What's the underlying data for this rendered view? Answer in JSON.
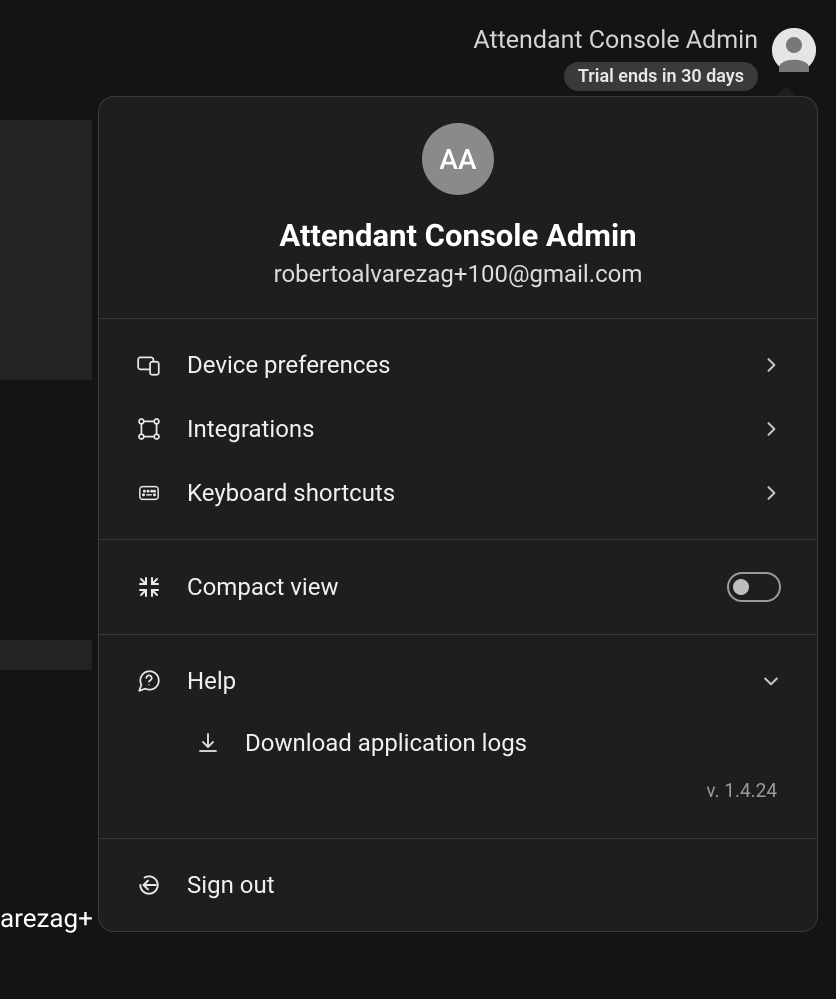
{
  "bg_partial_text": "arezag+",
  "header": {
    "title": "Attendant Console Admin",
    "trial_badge": "Trial ends in 30 days"
  },
  "profile": {
    "initials": "AA",
    "name": "Attendant Console Admin",
    "email": "robertoalvarezag+100@gmail.com"
  },
  "menu": {
    "device_prefs": "Device preferences",
    "integrations": "Integrations",
    "keyboard_shortcuts": "Keyboard shortcuts",
    "compact_view": "Compact view",
    "help": "Help",
    "download_logs": "Download application logs",
    "sign_out": "Sign out"
  },
  "compact_view_on": false,
  "version": "v. 1.4.24"
}
